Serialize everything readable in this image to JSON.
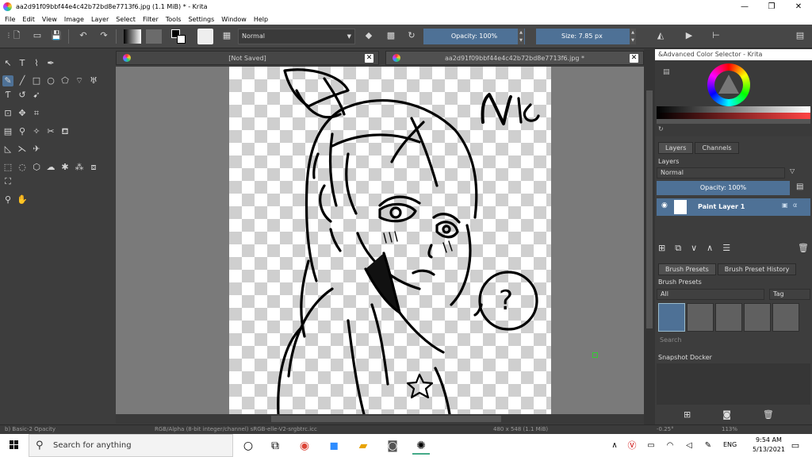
{
  "window": {
    "title": "aa2d91f09bbf44e4c42b72bd8e7713f6.jpg (1.1 MiB)  * - Krita",
    "minimize": "—",
    "restore": "❐",
    "close": "✕"
  },
  "menu": [
    "File",
    "Edit",
    "View",
    "Image",
    "Layer",
    "Select",
    "Filter",
    "Tools",
    "Settings",
    "Window",
    "Help"
  ],
  "toolbar": {
    "blend_mode": "Normal",
    "opacity": "Opacity: 100%",
    "size": "Size: 7.85 px"
  },
  "tabs": [
    {
      "title": "[Not Saved]"
    },
    {
      "title": "aa2d91f09bbf44e4c42b72bd8e7713f6.jpg *"
    }
  ],
  "dockers": {
    "advanced_color_selector": "&Advanced Color Selector - Krita",
    "layers_tabs": [
      "Layers",
      "Channels"
    ],
    "layers_title": "Layers",
    "layer_blend": "Normal",
    "layer_opacity": "Opacity:  100%",
    "layer_name": "Paint Layer 1",
    "brush_tabs": [
      "Brush Presets",
      "Brush Preset History"
    ],
    "brush_title": "Brush Presets",
    "brush_filter": "All",
    "brush_tag": "Tag",
    "brush_search": "Search",
    "snapshot_title": "Snapshot Docker"
  },
  "status": {
    "brush": "b) Basic-2 Opacity",
    "colorspace": "RGB/Alpha (8-bit integer/channel)  sRGB-elle-V2-srgbtrc.icc",
    "dimensions": "480 x 548 (1.1 MiB)",
    "rotation": "-0.25°",
    "zoom": "113%"
  },
  "taskbar": {
    "search_placeholder": "Search for anything",
    "lang": "ENG",
    "time": "9:54 AM",
    "date": "5/13/2021"
  },
  "drawing": {
    "signature_text": "NK",
    "bubble_text": "?"
  },
  "colors": {
    "accent": "#4e7196",
    "panel": "#3d3d3d",
    "toolbar": "#474747"
  }
}
